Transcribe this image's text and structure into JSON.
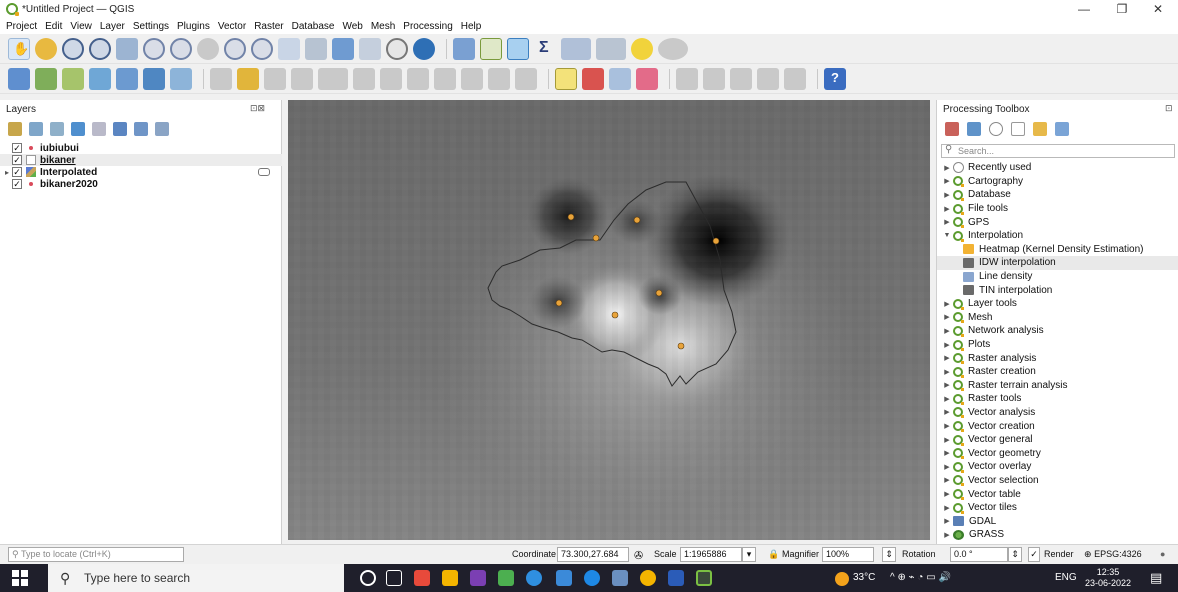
{
  "window": {
    "title": "*Untitled Project — QGIS",
    "minimize": "—",
    "maximize": "❐",
    "close": "✕"
  },
  "menu": [
    "Project",
    "Edit",
    "View",
    "Layer",
    "Settings",
    "Plugins",
    "Vector",
    "Raster",
    "Database",
    "Web",
    "Mesh",
    "Processing",
    "Help"
  ],
  "layers_panel": {
    "title": "Layers",
    "controls": "⊡⊠",
    "layers": [
      {
        "name": "iubiubui",
        "checked": true,
        "symbol": "point",
        "expandable": false,
        "underline": false,
        "selected": false
      },
      {
        "name": "bikaner",
        "checked": true,
        "symbol": "polygon",
        "expandable": false,
        "underline": true,
        "selected": true
      },
      {
        "name": "Interpolated",
        "checked": true,
        "symbol": "raster",
        "expandable": true,
        "underline": false,
        "selected": false
      },
      {
        "name": "bikaner2020",
        "checked": true,
        "symbol": "point",
        "expandable": false,
        "underline": false,
        "selected": false
      }
    ]
  },
  "toolbox": {
    "title": "Processing Toolbox",
    "control": "⊡",
    "search_placeholder": "Search...",
    "items": [
      {
        "label": "Recently used",
        "type": "recent",
        "expanded": false
      },
      {
        "label": "Cartography",
        "type": "group",
        "expanded": false
      },
      {
        "label": "Database",
        "type": "group",
        "expanded": false
      },
      {
        "label": "File tools",
        "type": "group",
        "expanded": false
      },
      {
        "label": "GPS",
        "type": "group",
        "expanded": false
      },
      {
        "label": "Interpolation",
        "type": "group",
        "expanded": true
      },
      {
        "label": "Heatmap (Kernel Density Estimation)",
        "type": "algorithm",
        "icon_color": "#f2b233"
      },
      {
        "label": "IDW interpolation",
        "type": "algorithm",
        "icon_color": "#6a6a6a",
        "selected": true
      },
      {
        "label": "Line density",
        "type": "algorithm",
        "icon_color": "#8aa6cf"
      },
      {
        "label": "TIN interpolation",
        "type": "algorithm",
        "icon_color": "#6a6a6a"
      },
      {
        "label": "Layer tools",
        "type": "group",
        "expanded": false
      },
      {
        "label": "Mesh",
        "type": "group",
        "expanded": false
      },
      {
        "label": "Network analysis",
        "type": "group",
        "expanded": false
      },
      {
        "label": "Plots",
        "type": "group",
        "expanded": false
      },
      {
        "label": "Raster analysis",
        "type": "group",
        "expanded": false
      },
      {
        "label": "Raster creation",
        "type": "group",
        "expanded": false
      },
      {
        "label": "Raster terrain analysis",
        "type": "group",
        "expanded": false
      },
      {
        "label": "Raster tools",
        "type": "group",
        "expanded": false
      },
      {
        "label": "Vector analysis",
        "type": "group",
        "expanded": false
      },
      {
        "label": "Vector creation",
        "type": "group",
        "expanded": false
      },
      {
        "label": "Vector general",
        "type": "group",
        "expanded": false
      },
      {
        "label": "Vector geometry",
        "type": "group",
        "expanded": false
      },
      {
        "label": "Vector overlay",
        "type": "group",
        "expanded": false
      },
      {
        "label": "Vector selection",
        "type": "group",
        "expanded": false
      },
      {
        "label": "Vector table",
        "type": "group",
        "expanded": false
      },
      {
        "label": "Vector tiles",
        "type": "group",
        "expanded": false
      },
      {
        "label": "GDAL",
        "type": "gdal",
        "expanded": false
      },
      {
        "label": "GRASS",
        "type": "grass",
        "expanded": false
      }
    ]
  },
  "statusbar": {
    "locate_placeholder": "Type to locate (Ctrl+K)",
    "coordinate_label": "Coordinate",
    "coordinate_value": "73.300,27.684",
    "scale_label": "Scale",
    "scale_value": "1:1965886",
    "magnifier_label": "Magnifier",
    "magnifier_value": "100%",
    "rotation_label": "Rotation",
    "rotation_value": "0.0 °",
    "render_label": "Render",
    "crs": "EPSG:4326"
  },
  "taskbar": {
    "search_placeholder": "Type here to search",
    "weather": "33°C",
    "language": "ENG",
    "time": "12:35",
    "date": "23-06-2022"
  },
  "colors": {
    "qgis_green": "#5b9b2e",
    "point_fill": "#e8a33a",
    "taskbar": "#1f1f2b"
  }
}
